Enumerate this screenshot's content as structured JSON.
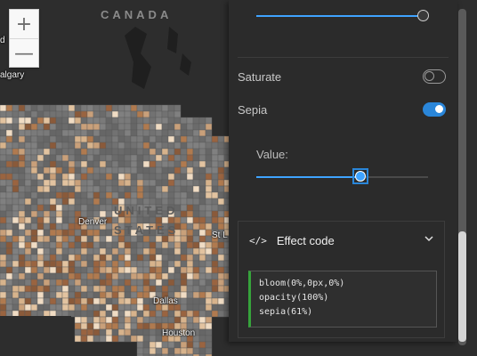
{
  "map": {
    "labels": {
      "canada": "CANADA",
      "us_line1": "UNITED",
      "us_line2": "STATES",
      "calgary": "algary",
      "denver": "Denver",
      "dallas": "Dallas",
      "houston": "Houston",
      "stlouis": "St L",
      "canada_left": "d"
    },
    "zoom": {
      "in_symbol": "+",
      "out_symbol": "—"
    }
  },
  "panel": {
    "top_slider": {
      "value_fraction": 1.0
    },
    "saturate": {
      "label": "Saturate",
      "enabled": false
    },
    "sepia": {
      "label": "Sepia",
      "enabled": true
    },
    "value_slider": {
      "label": "Value:",
      "value_fraction": 0.61
    },
    "effect_code": {
      "icon": "code-icon",
      "title": "Effect code",
      "expand_icon": "chevron-down-icon",
      "lines": [
        "bloom(0%,0px,0%)",
        "opacity(100%)",
        "sepia(61%)"
      ]
    },
    "colors": {
      "accent": "#2a86d9",
      "code_bar": "#36a33b"
    }
  }
}
